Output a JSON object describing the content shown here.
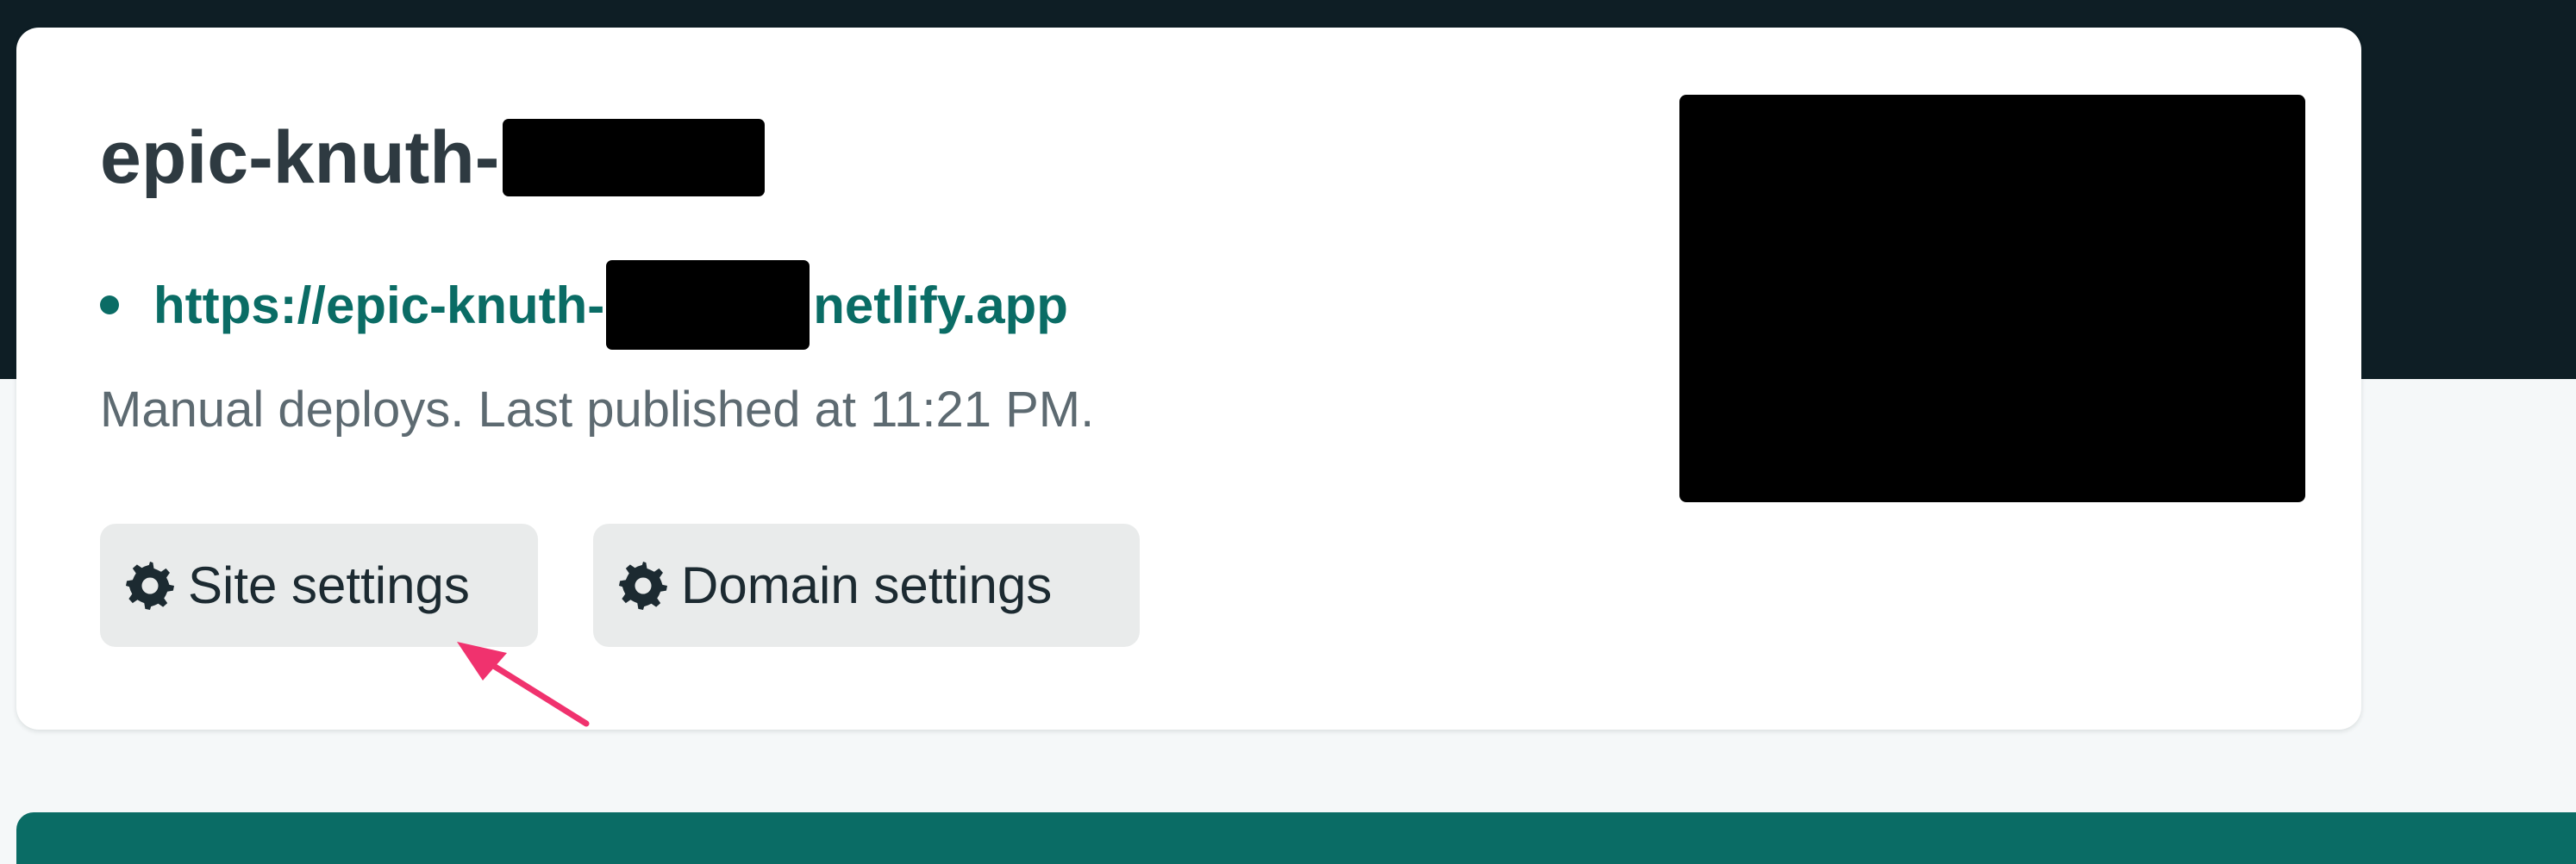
{
  "site": {
    "name_prefix": "epic-knuth-",
    "url_prefix": "https://epic-knuth-",
    "url_suffix": "netlify.app",
    "deploy_status": "Manual deploys. Last published at 11:21 PM."
  },
  "actions": {
    "site_settings_label": "Site settings",
    "domain_settings_label": "Domain settings"
  },
  "icons": {
    "settings": "gear-icon",
    "annotation": "annotation-arrow"
  },
  "colors": {
    "header_background": "#0e1e25",
    "accent_teal": "#0a6c65",
    "annotation_arrow": "#f0326e"
  }
}
